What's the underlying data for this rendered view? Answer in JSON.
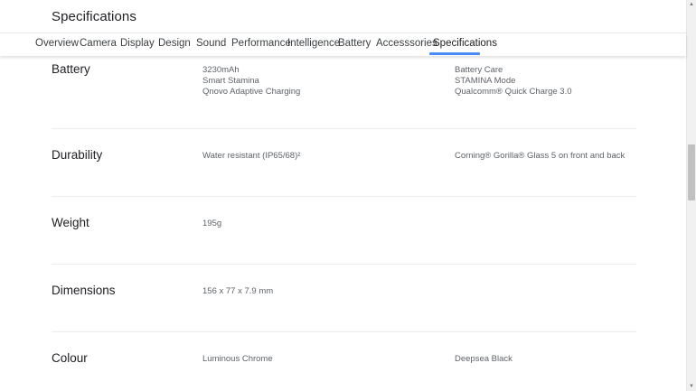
{
  "header": {
    "title": "Specifications"
  },
  "tabs": [
    {
      "label": "Overview"
    },
    {
      "label": "Camera"
    },
    {
      "label": "Display"
    },
    {
      "label": "Design"
    },
    {
      "label": "Sound"
    },
    {
      "label": "Performance"
    },
    {
      "label": "Intelligence"
    },
    {
      "label": "Battery"
    },
    {
      "label": "Accesssories"
    },
    {
      "label": "Specifications"
    }
  ],
  "active_tab": "Specifications",
  "accent_color": "#4a8cf7",
  "specs": {
    "battery": {
      "title": "Battery",
      "col1": [
        "3230mAh",
        "Smart Stamina",
        "Qnovo Adaptive Charging"
      ],
      "col2": [
        "Battery Care",
        "STAMINA Mode",
        "Qualcomm® Quick Charge 3.0"
      ]
    },
    "durability": {
      "title": "Durability",
      "col1": [
        "Water resistant (IP65/68)²"
      ],
      "col2": [
        "Corning® Gorilla® Glass 5 on front and back"
      ]
    },
    "weight": {
      "title": "Weight",
      "col1": [
        "195g"
      ]
    },
    "dimensions": {
      "title": "Dimensions",
      "col1": [
        "156 x 77 x 7.9 mm"
      ]
    },
    "colour": {
      "title": "Colour",
      "col1": [
        "Luminous Chrome"
      ],
      "col2": [
        "Deepsea Black"
      ]
    }
  },
  "scrollbar": {
    "up_icon": "▲",
    "down_icon": "▼"
  }
}
